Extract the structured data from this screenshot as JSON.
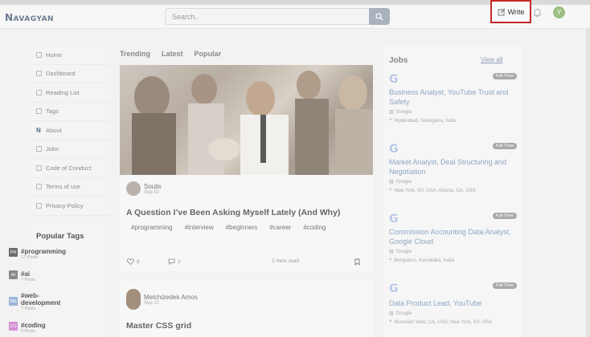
{
  "header": {
    "logo_text": "NAVAGYAN",
    "search_placeholder": "Search..",
    "write_label": "Write",
    "user_initial": "Y"
  },
  "sidebar": {
    "items": [
      {
        "label": "Home",
        "icon": "home-icon"
      },
      {
        "label": "Dashboard",
        "icon": "dashboard-icon"
      },
      {
        "label": "Reading List",
        "icon": "reading-list-icon"
      },
      {
        "label": "Tags",
        "icon": "tag-icon"
      },
      {
        "label": "About",
        "icon": "navagyan-logo-icon"
      },
      {
        "label": "Jobs",
        "icon": "briefcase-icon"
      },
      {
        "label": "Code of Conduct",
        "icon": "document-icon"
      },
      {
        "label": "Terms of use",
        "icon": "terms-icon"
      },
      {
        "label": "Privacy Policy",
        "icon": "shield-icon"
      }
    ]
  },
  "popular_tags": {
    "heading": "Popular Tags",
    "tags": [
      {
        "name": "#programming",
        "posts": "12 Posts",
        "abbr": "PR",
        "color": "#6b6b6b"
      },
      {
        "name": "#ai",
        "posts": "7 Posts",
        "abbr": "AI",
        "color": "#8a8a8a"
      },
      {
        "name": "#web-development",
        "name1": "#web-",
        "name2": "development",
        "posts": "7 Posts",
        "abbr": "WE",
        "color": "#9bb3d9"
      },
      {
        "name": "#coding",
        "posts": "5 Posts",
        "abbr": "CO",
        "color": "#d48fd6"
      }
    ]
  },
  "feed": {
    "tabs": [
      "Trending",
      "Latest",
      "Popular"
    ],
    "posts": [
      {
        "author": "Soulis",
        "date": "Sep 02",
        "title": "A Question I’ve Been Asking Myself Lately (And Why)",
        "hashtags": [
          "#programming",
          "#interview",
          "#beginners",
          "#career",
          "#coding"
        ],
        "likes": "8",
        "comments": "2",
        "read_time": "2 mins read"
      },
      {
        "author": "Melchizedek Amos",
        "date": "Sep 12",
        "title": "Master CSS grid"
      }
    ]
  },
  "jobs": {
    "heading": "Jobs",
    "view_all": "View all",
    "list": [
      {
        "title": "Business Analyst, YouTube Trust and Safety",
        "company": "Google",
        "location": "Hyderabad, Telangana, India",
        "type": "Full Time"
      },
      {
        "title": "Market Analyst, Deal Structuring and Negotiation",
        "company": "Google",
        "location": "New York, NY, USA; Atlanta, GA, USA",
        "type": "Full Time"
      },
      {
        "title": "Commission Accounting Data Analyst, Google Cloud",
        "company": "Google",
        "location": "Bengaluru, Karnataka, India",
        "type": "Full Time"
      },
      {
        "title": "Data Product Lead, YouTube",
        "company": "Google",
        "location": "Mountain View, CA, USA; New York, NY, USA",
        "type": "Full Time"
      }
    ]
  }
}
